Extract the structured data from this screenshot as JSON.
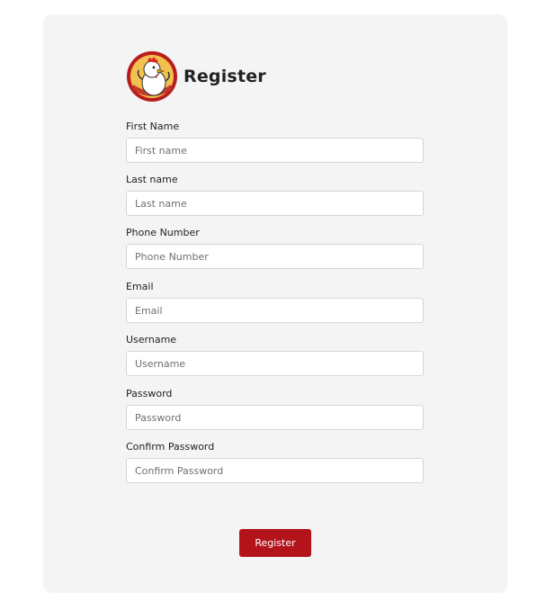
{
  "form": {
    "title": "Register",
    "logo_icon": "chicken-mascot-logo",
    "fields": [
      {
        "label": "First Name",
        "placeholder": "First name",
        "value": ""
      },
      {
        "label": "Last name",
        "placeholder": "Last name",
        "value": ""
      },
      {
        "label": "Phone Number",
        "placeholder": "Phone Number",
        "value": ""
      },
      {
        "label": "Email",
        "placeholder": "Email",
        "value": ""
      },
      {
        "label": "Username",
        "placeholder": "Username",
        "value": ""
      },
      {
        "label": "Password",
        "placeholder": "Password",
        "value": ""
      },
      {
        "label": "Confirm Password",
        "placeholder": "Confirm Password",
        "value": ""
      }
    ],
    "submit_label": "Register"
  },
  "colors": {
    "brand": "#b3141b",
    "card_background": "#f4f4f4"
  }
}
